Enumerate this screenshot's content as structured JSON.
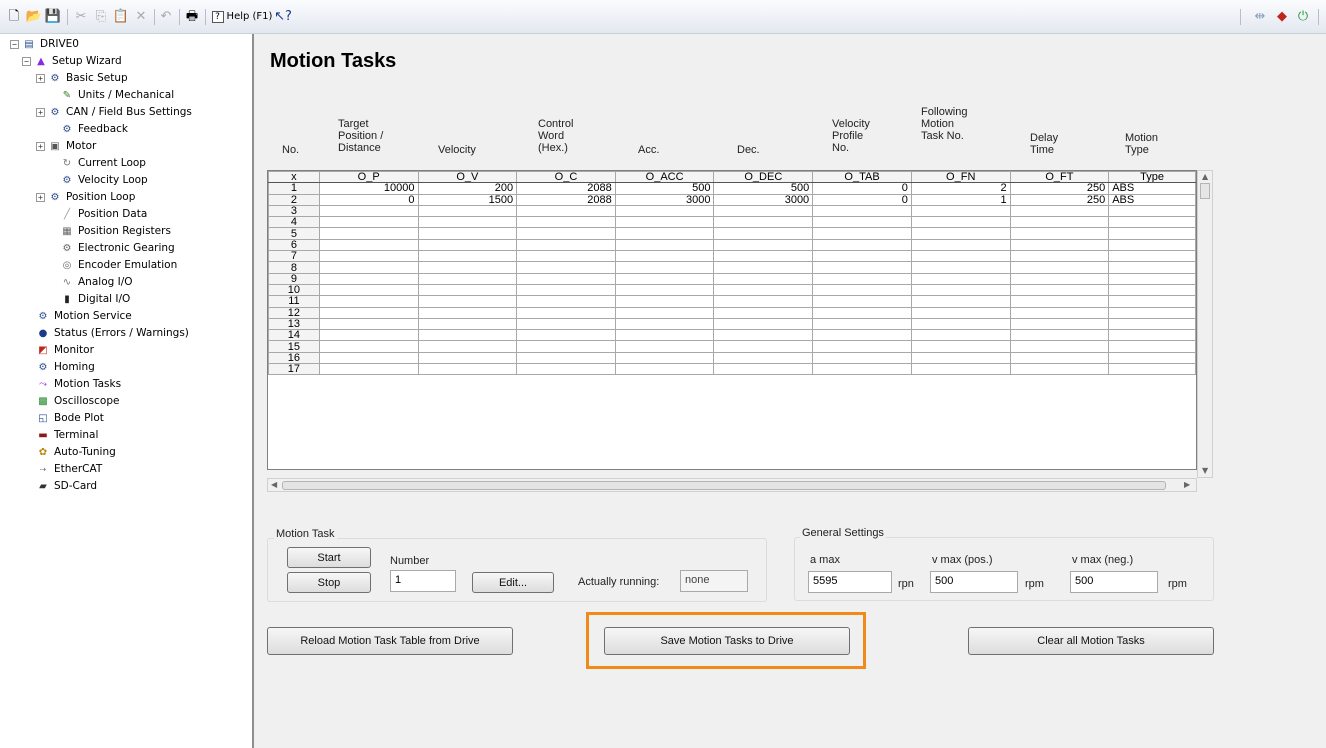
{
  "toolbar": {
    "help_label": "Help (F1)"
  },
  "tree": {
    "items": [
      {
        "label": "DRIVE0"
      },
      {
        "label": "Setup Wizard"
      },
      {
        "label": "Basic Setup"
      },
      {
        "label": "Units / Mechanical"
      },
      {
        "label": "CAN / Field Bus Settings"
      },
      {
        "label": "Feedback"
      },
      {
        "label": "Motor"
      },
      {
        "label": "Current Loop"
      },
      {
        "label": "Velocity Loop"
      },
      {
        "label": "Position Loop"
      },
      {
        "label": "Position Data"
      },
      {
        "label": "Position Registers"
      },
      {
        "label": "Electronic Gearing"
      },
      {
        "label": "Encoder Emulation"
      },
      {
        "label": "Analog I/O"
      },
      {
        "label": "Digital I/O"
      },
      {
        "label": "Motion Service"
      },
      {
        "label": "Status (Errors / Warnings)"
      },
      {
        "label": "Monitor"
      },
      {
        "label": "Homing"
      },
      {
        "label": "Motion Tasks"
      },
      {
        "label": "Oscilloscope"
      },
      {
        "label": "Bode Plot"
      },
      {
        "label": "Terminal"
      },
      {
        "label": "Auto-Tuning"
      },
      {
        "label": "EtherCAT"
      },
      {
        "label": "SD-Card"
      }
    ]
  },
  "page": {
    "title": "Motion Tasks"
  },
  "table": {
    "headers": [
      "No.",
      "Target\nPosition /\nDistance",
      "Velocity",
      "Control\nWord\n(Hex.)",
      "Acc.",
      "Dec.",
      "Velocity\nProfile\nNo.",
      "Following\nMotion\nTask No.",
      "Delay\nTime",
      "Motion\nType"
    ],
    "keys": [
      "x",
      "O_P",
      "O_V",
      "O_C",
      "O_ACC",
      "O_DEC",
      "O_TAB",
      "O_FN",
      "O_FT",
      "Type"
    ],
    "rows": [
      [
        "1",
        "10000",
        "200",
        "2088",
        "500",
        "500",
        "0",
        "2",
        "250",
        "ABS"
      ],
      [
        "2",
        "0",
        "1500",
        "2088",
        "3000",
        "3000",
        "0",
        "1",
        "250",
        "ABS"
      ],
      [
        "3",
        "",
        "",
        "",
        "",
        "",
        "",
        "",
        "",
        ""
      ],
      [
        "4",
        "",
        "",
        "",
        "",
        "",
        "",
        "",
        "",
        ""
      ],
      [
        "5",
        "",
        "",
        "",
        "",
        "",
        "",
        "",
        "",
        ""
      ],
      [
        "6",
        "",
        "",
        "",
        "",
        "",
        "",
        "",
        "",
        ""
      ],
      [
        "7",
        "",
        "",
        "",
        "",
        "",
        "",
        "",
        "",
        ""
      ],
      [
        "8",
        "",
        "",
        "",
        "",
        "",
        "",
        "",
        "",
        ""
      ],
      [
        "9",
        "",
        "",
        "",
        "",
        "",
        "",
        "",
        "",
        ""
      ],
      [
        "10",
        "",
        "",
        "",
        "",
        "",
        "",
        "",
        "",
        ""
      ],
      [
        "11",
        "",
        "",
        "",
        "",
        "",
        "",
        "",
        "",
        ""
      ],
      [
        "12",
        "",
        "",
        "",
        "",
        "",
        "",
        "",
        "",
        ""
      ],
      [
        "13",
        "",
        "",
        "",
        "",
        "",
        "",
        "",
        "",
        ""
      ],
      [
        "14",
        "",
        "",
        "",
        "",
        "",
        "",
        "",
        "",
        ""
      ],
      [
        "15",
        "",
        "",
        "",
        "",
        "",
        "",
        "",
        "",
        ""
      ],
      [
        "16",
        "",
        "",
        "",
        "",
        "",
        "",
        "",
        "",
        ""
      ],
      [
        "17",
        "",
        "",
        "",
        "",
        "",
        "",
        "",
        "",
        ""
      ]
    ]
  },
  "motion_task": {
    "group_label": "Motion Task",
    "start_label": "Start",
    "stop_label": "Stop",
    "number_label": "Number",
    "number_value": "1",
    "edit_label": "Edit...",
    "running_label": "Actually running:",
    "running_value": "none"
  },
  "general": {
    "group_label": "General Settings",
    "amax_label": "a max",
    "amax_value": "5595",
    "amax_unit": "rpn",
    "vmax_pos_label": "v max (pos.)",
    "vmax_pos_value": "500",
    "vmax_pos_unit": "rpm",
    "vmax_neg_label": "v max (neg.)",
    "vmax_neg_value": "500",
    "vmax_neg_unit": "rpm"
  },
  "actions": {
    "reload_label": "Reload Motion Task Table from Drive",
    "save_label": "Save Motion Tasks to Drive",
    "clear_label": "Clear all Motion Tasks"
  },
  "colors": {
    "highlight": "#f28a1a"
  }
}
